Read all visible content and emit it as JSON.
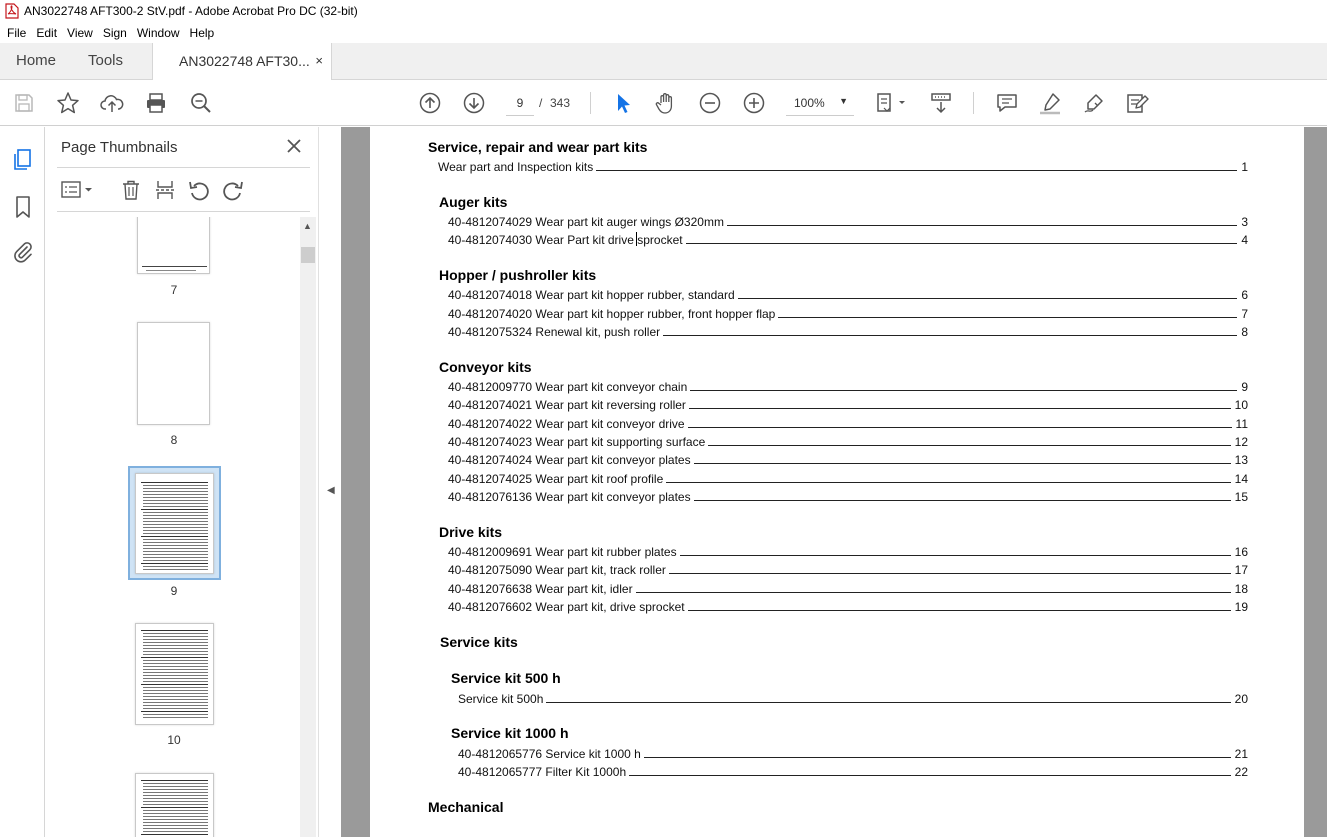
{
  "window": {
    "title": "AN3022748 AFT300-2 StV.pdf - Adobe Acrobat Pro DC (32-bit)"
  },
  "menu": [
    "File",
    "Edit",
    "View",
    "Sign",
    "Window",
    "Help"
  ],
  "tabs": {
    "home": "Home",
    "tools": "Tools",
    "document": "AN3022748 AFT30...",
    "close": "×"
  },
  "toolbar": {
    "current_page": "9",
    "separator": "/",
    "total_pages": "343",
    "zoom": "100%",
    "icons": [
      "save-icon",
      "star-icon",
      "upload-icon",
      "print-icon",
      "find-icon",
      "page-up-icon",
      "page-down-icon",
      "select-cursor-icon",
      "hand-icon",
      "zoom-out-icon",
      "zoom-in-icon",
      "page-fit-icon",
      "scroll-mode-icon",
      "comment-icon",
      "highlight-icon",
      "draw-icon",
      "fill-sign-icon"
    ]
  },
  "thumbnails_panel": {
    "title": "Page Thumbnails",
    "pages": [
      "7",
      "8",
      "9",
      "10"
    ],
    "selected": "9"
  },
  "document": {
    "toc": {
      "main_heading": "Service, repair and wear part kits",
      "intro": {
        "text": "Wear part and Inspection kits",
        "page": "1"
      },
      "sections": [
        {
          "heading": "Auger kits",
          "entries": [
            {
              "text": "40-4812074029 Wear part kit auger wings Ø320mm",
              "page": "3"
            },
            {
              "text": "40-4812074030 Wear Part kit drive sprocket",
              "page": "4"
            }
          ]
        },
        {
          "heading": "Hopper / pushroller kits",
          "entries": [
            {
              "text": "40-4812074018 Wear part kit hopper rubber, standard",
              "page": "6"
            },
            {
              "text": "40-4812074020 Wear part kit hopper rubber, front hopper flap",
              "page": "7"
            },
            {
              "text": "40-4812075324 Renewal kit, push roller",
              "page": "8"
            }
          ]
        },
        {
          "heading": "Conveyor kits",
          "entries": [
            {
              "text": "40-4812009770 Wear part kit conveyor chain",
              "page": "9"
            },
            {
              "text": "40-4812074021 Wear part kit reversing roller",
              "page": "10"
            },
            {
              "text": "40-4812074022 Wear part kit conveyor drive",
              "page": "11"
            },
            {
              "text": "40-4812074023 Wear part kit supporting surface",
              "page": "12"
            },
            {
              "text": "40-4812074024 Wear part kit conveyor plates",
              "page": "13"
            },
            {
              "text": "40-4812074025 Wear part kit roof profile",
              "page": "14"
            },
            {
              "text": "40-4812076136 Wear part kit conveyor plates",
              "page": "15"
            }
          ]
        },
        {
          "heading": "Drive kits",
          "entries": [
            {
              "text": "40-4812009691 Wear part kit rubber plates",
              "page": "16"
            },
            {
              "text": "40-4812075090 Wear part kit, track roller",
              "page": "17"
            },
            {
              "text": "40-4812076638 Wear part kit, idler",
              "page": "18"
            },
            {
              "text": "40-4812076602 Wear part kit, drive sprocket",
              "page": "19"
            }
          ]
        }
      ],
      "service_kits": {
        "heading": "Service kits",
        "subsections": [
          {
            "heading": "Service kit 500 h",
            "entries": [
              {
                "text": "Service kit 500h",
                "page": "20"
              }
            ]
          },
          {
            "heading": "Service kit 1000 h",
            "entries": [
              {
                "text": "40-4812065776 Service kit 1000 h",
                "page": "21"
              },
              {
                "text": "40-4812065777 Filter Kit 1000h",
                "page": "22"
              }
            ]
          }
        ]
      },
      "next_heading": "Mechanical"
    }
  }
}
